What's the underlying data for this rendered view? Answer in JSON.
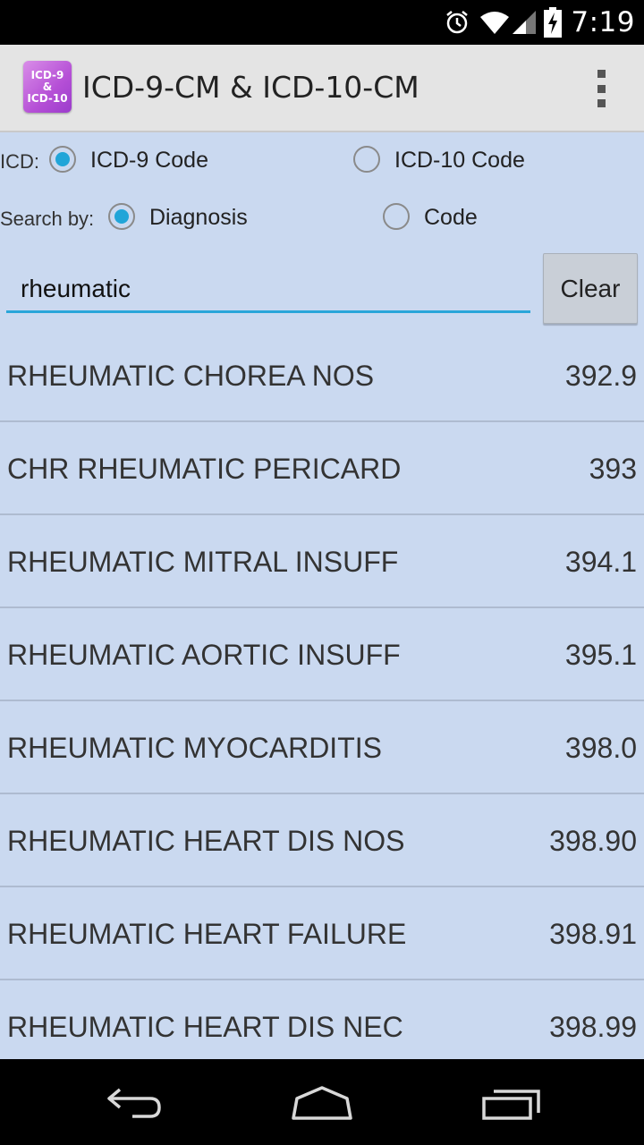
{
  "status_bar": {
    "time": "7:19",
    "icons": [
      "alarm-icon",
      "wifi-icon",
      "signal-icon",
      "battery-charging-icon"
    ]
  },
  "action_bar": {
    "app_icon_text": [
      "ICD-9",
      "&",
      "ICD-10"
    ],
    "title": "ICD-9-CM & ICD-10-CM",
    "overflow_icon": "overflow-menu-icon"
  },
  "icd_group": {
    "label": "ICD:",
    "options": [
      {
        "label": "ICD-9 Code",
        "checked": true
      },
      {
        "label": "ICD-10 Code",
        "checked": false
      }
    ]
  },
  "search_by_group": {
    "label": "Search by:",
    "options": [
      {
        "label": "Diagnosis",
        "checked": true
      },
      {
        "label": "Code",
        "checked": false
      }
    ]
  },
  "search": {
    "value": "rheumatic",
    "clear_label": "Clear"
  },
  "results": [
    {
      "diagnosis": "RHEUMATIC CHOREA NOS",
      "code": "392.9"
    },
    {
      "diagnosis": "CHR RHEUMATIC PERICARD",
      "code": "393"
    },
    {
      "diagnosis": "RHEUMATIC MITRAL INSUFF",
      "code": "394.1"
    },
    {
      "diagnosis": "RHEUMATIC AORTIC INSUFF",
      "code": "395.1"
    },
    {
      "diagnosis": "RHEUMATIC MYOCARDITIS",
      "code": "398.0"
    },
    {
      "diagnosis": "RHEUMATIC HEART DIS NOS",
      "code": "398.90"
    },
    {
      "diagnosis": "RHEUMATIC HEART FAILURE",
      "code": "398.91"
    },
    {
      "diagnosis": "RHEUMATIC HEART DIS NEC",
      "code": "398.99"
    }
  ],
  "nav_bar": {
    "icons": [
      "back-icon",
      "home-icon",
      "recent-apps-icon"
    ]
  },
  "colors": {
    "content_background": "#cad9f0",
    "accent": "#21a5d8",
    "action_bar": "#e4e4e4"
  }
}
